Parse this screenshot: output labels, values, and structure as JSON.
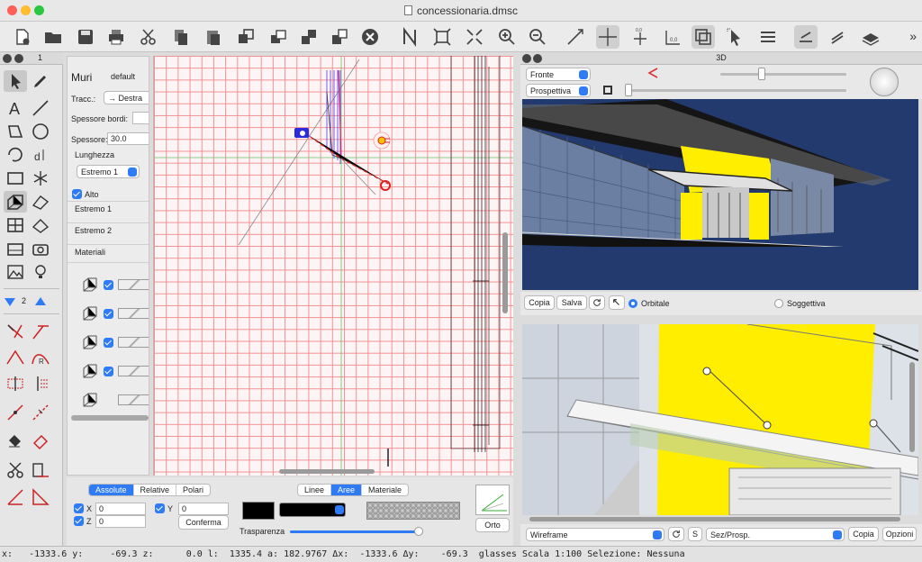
{
  "window": {
    "title": "concessionaria.dmsc"
  },
  "toolbar": {
    "icons": [
      "new-file",
      "open-folder",
      "save",
      "print",
      "cut",
      "copy",
      "paste",
      "transform",
      "group",
      "ungroup",
      "combine",
      "delete",
      "north",
      "fit",
      "expand",
      "zoom-in",
      "zoom-out",
      "line-tool",
      "crosshair",
      "snap-point",
      "dimension",
      "layers",
      "select-arrow",
      "menu",
      "align",
      "rotate",
      "3d-model"
    ],
    "more": "»"
  },
  "palette": {
    "page": "1",
    "zoom": "2"
  },
  "props": {
    "title": "Muri",
    "style": "default",
    "tracc_label": "Tracc.:",
    "tracc_value": "→ Destra",
    "spessore_bordi_label": "Spessore bordi:",
    "spessore_label": "Spessore:",
    "spessore_value": "30.0",
    "lunghezza_label": "Lunghezza",
    "estremo_popup": "Estremo 1",
    "alto_label": "Alto",
    "estremo1": "Estremo 1",
    "estremo2": "Estremo 2",
    "materiali": "Materiali"
  },
  "coords": {
    "tabs": [
      "Assolute",
      "Relative",
      "Polari"
    ],
    "active_tab": "Assolute",
    "x_label": "X",
    "x_value": "0",
    "y_label": "Y",
    "y_value": "0",
    "z_label": "Z",
    "z_value": "0",
    "confirm": "Conferma"
  },
  "appearance": {
    "tabs": [
      "Linee",
      "Aree",
      "Materiale"
    ],
    "active_tab": "Aree",
    "trasparenza": "Trasparenza",
    "color": "#000000",
    "orto": "Orto"
  },
  "view3d": {
    "title": "3D",
    "view_popup": "Fronte",
    "projection_popup": "Prospettiva",
    "copy": "Copia",
    "save": "Salva",
    "orbitale": "Orbitale",
    "soggettiva": "Soggettiva"
  },
  "wire": {
    "render_popup": "Wireframe",
    "s_button": "S",
    "section_popup": "Sez/Prosp.",
    "copy": "Copia",
    "options": "Opzioni"
  },
  "status": {
    "text": "x:   -1333.6 y:     -69.3 z:      0.0 l:  1335.4 a: 182.9767 Δx:  -1333.6 Δy:    -69.3  glasses Scala 1:100 Selezione: Nessuna"
  },
  "colors": {
    "accent": "#2f7bf5",
    "grid": "#f29090",
    "yellow": "#ffee00",
    "navy": "#223a6e"
  }
}
